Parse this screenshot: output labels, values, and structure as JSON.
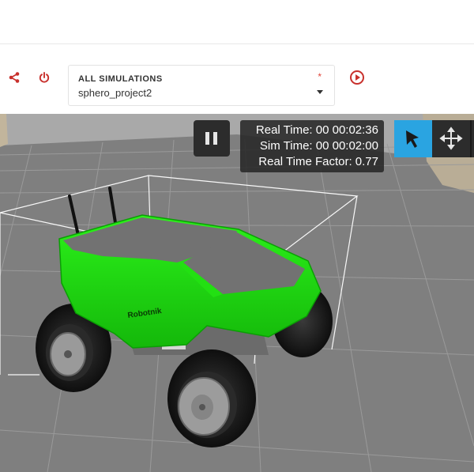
{
  "simulation": {
    "label": "ALL SIMULATIONS",
    "required_marker": "*",
    "selected": "sphero_project2"
  },
  "toolbar_icons": [
    "share-icon",
    "power-icon",
    "play-circle-icon"
  ],
  "viewport": {
    "status": {
      "real_time": "Real Time: 00 00:02:36",
      "sim_time": "Sim Time: 00 00:02:00",
      "real_time_factor": "Real Time Factor: 0.77"
    },
    "tools": [
      "select-arrow-icon",
      "translate-arrows-icon"
    ],
    "robot_label": "Robotnik"
  },
  "colors": {
    "accent_red": "#c8302c",
    "tool_active": "#2aa4e1",
    "robot_green": "#22e012",
    "ground": "#7f7f7f"
  }
}
